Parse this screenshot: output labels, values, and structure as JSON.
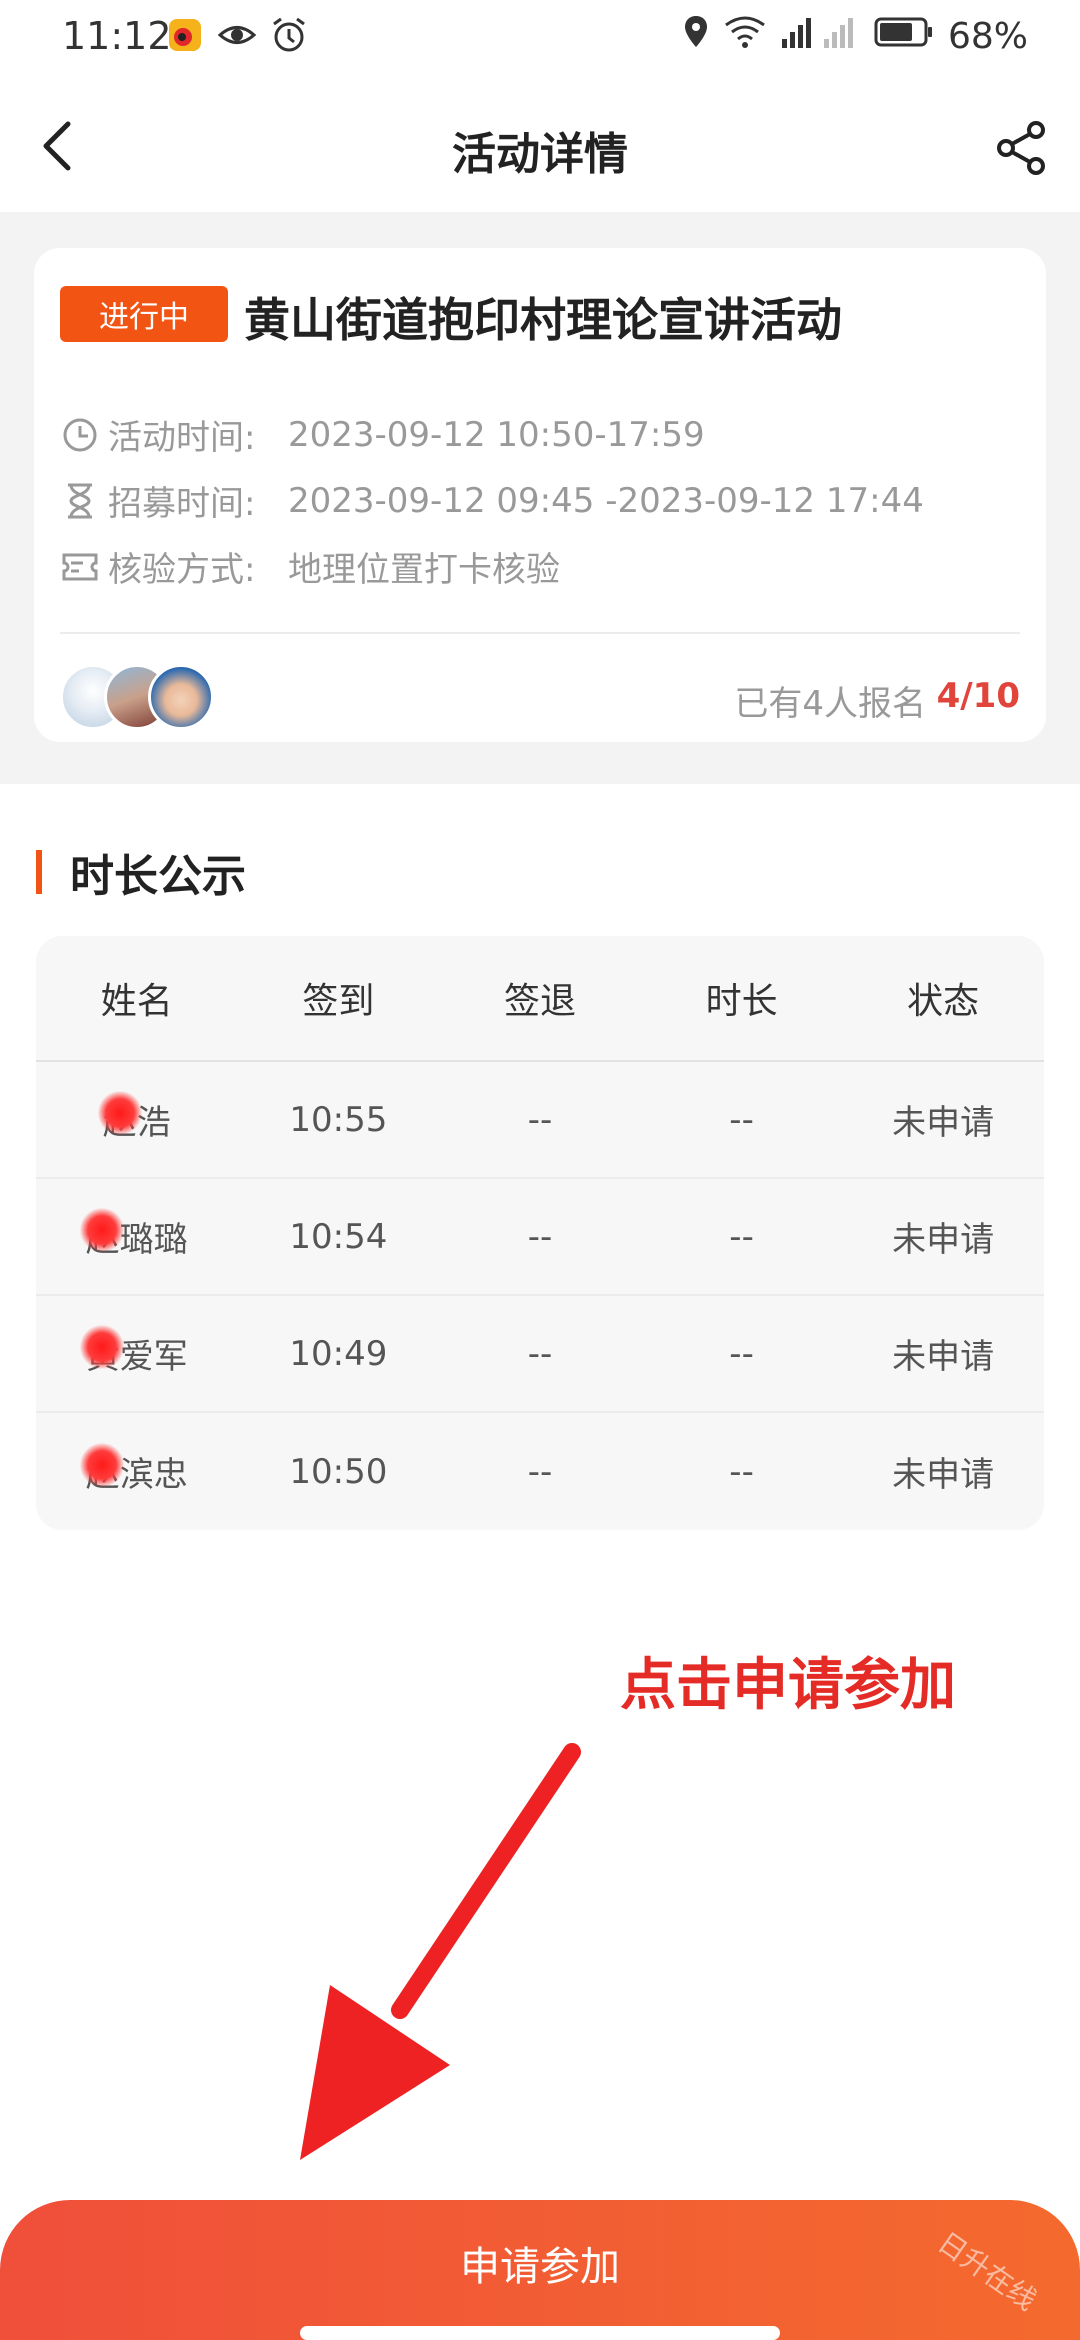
{
  "status_bar": {
    "time": "11:12",
    "battery": "68%",
    "icons": [
      "weibo-icon",
      "eye-icon",
      "alarm-icon",
      "location-icon",
      "wifi-icon",
      "signal-icon",
      "battery-icon"
    ]
  },
  "nav": {
    "title": "活动详情",
    "back_icon": "chevron-left-icon",
    "share_icon": "share-icon"
  },
  "activity": {
    "status_badge": "进行中",
    "title": "黄山街道抱印村理论宣讲活动",
    "rows": [
      {
        "icon": "clock-icon",
        "label": "活动时间:",
        "value": "2023-09-12 10:50-17:59"
      },
      {
        "icon": "hourglass-icon",
        "label": "招募时间:",
        "value": "2023-09-12 09:45 -2023-09-12 17:44"
      },
      {
        "icon": "ticket-icon",
        "label": "核验方式:",
        "value": "地理位置打卡核验"
      }
    ],
    "signup_text": "已有4人报名",
    "signup_count": "4/10"
  },
  "duration_section": {
    "title": "时长公示",
    "columns": [
      "姓名",
      "签到",
      "签退",
      "时长",
      "状态"
    ],
    "rows": [
      {
        "name": "赵浩",
        "checkin": "10:55",
        "checkout": "--",
        "duration": "--",
        "status": "未申请"
      },
      {
        "name": "赵璐璐",
        "checkin": "10:54",
        "checkout": "--",
        "duration": "--",
        "status": "未申请"
      },
      {
        "name": "黄爱军",
        "checkin": "10:49",
        "checkout": "--",
        "duration": "--",
        "status": "未申请"
      },
      {
        "name": "赵滨忠",
        "checkin": "10:50",
        "checkout": "--",
        "duration": "--",
        "status": "未申请"
      }
    ]
  },
  "annotation": {
    "text": "点击申请参加",
    "color": "#e52b26"
  },
  "apply_button": {
    "label": "申请参加"
  },
  "watermark": "日升在线",
  "colors": {
    "accent": "#f25414",
    "count_red": "#e0443a"
  }
}
